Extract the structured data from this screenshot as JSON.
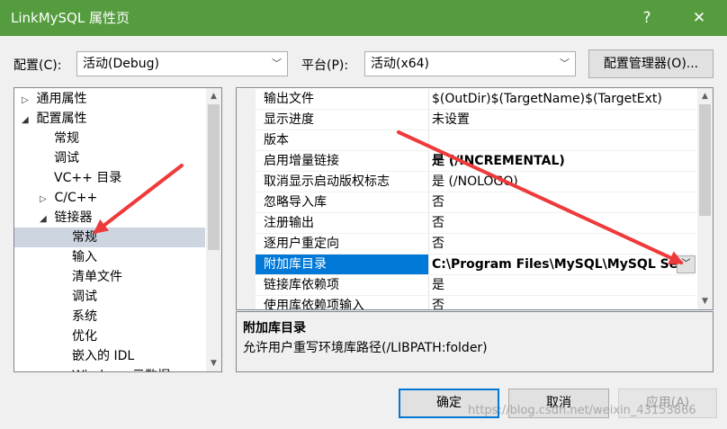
{
  "window": {
    "title": "LinkMySQL 属性页",
    "help_glyph": "?",
    "close_glyph": "✕"
  },
  "toolbar": {
    "config_label": "配置(C):",
    "config_value": "活动(Debug)",
    "platform_label": "平台(P):",
    "platform_value": "活动(x64)",
    "config_manager_label": "配置管理器(O)..."
  },
  "tree": {
    "items": [
      {
        "label": "通用属性",
        "arrow": "▷"
      },
      {
        "label": "配置属性",
        "arrow": "◢"
      },
      {
        "label": "常规",
        "arrow": ""
      },
      {
        "label": "调试",
        "arrow": ""
      },
      {
        "label": "VC++ 目录",
        "arrow": ""
      },
      {
        "label": "C/C++",
        "arrow": "▷"
      },
      {
        "label": "链接器",
        "arrow": "◢"
      },
      {
        "label": "常规",
        "arrow": ""
      },
      {
        "label": "输入",
        "arrow": ""
      },
      {
        "label": "清单文件",
        "arrow": ""
      },
      {
        "label": "调试",
        "arrow": ""
      },
      {
        "label": "系统",
        "arrow": ""
      },
      {
        "label": "优化",
        "arrow": ""
      },
      {
        "label": "嵌入的 IDL",
        "arrow": ""
      },
      {
        "label": "Windows 元数据",
        "arrow": ""
      }
    ]
  },
  "properties": [
    {
      "name": "输出文件",
      "value": "$(OutDir)$(TargetName)$(TargetExt)"
    },
    {
      "name": "显示进度",
      "value": "未设置"
    },
    {
      "name": "版本",
      "value": ""
    },
    {
      "name": "启用增量链接",
      "value": "是 (/INCREMENTAL)"
    },
    {
      "name": "取消显示启动版权标志",
      "value": "是 (/NOLOGO)"
    },
    {
      "name": "忽略导入库",
      "value": "否"
    },
    {
      "name": "注册输出",
      "value": "否"
    },
    {
      "name": "逐用户重定向",
      "value": "否"
    },
    {
      "name": "附加库目录",
      "value": "C:\\Program Files\\MySQL\\MySQL Server"
    },
    {
      "name": "链接库依赖项",
      "value": "是"
    },
    {
      "name": "使用库依赖项输入",
      "value": "否"
    }
  ],
  "description": {
    "title": "附加库目录",
    "text": "允许用户重写环境库路径(/LIBPATH:folder)"
  },
  "buttons": {
    "ok": "确定",
    "cancel": "取消",
    "apply": "应用(A)"
  },
  "watermark": "https://blog.csdn.net/weixin_43153866",
  "colors": {
    "titlebar": "#549c3e",
    "selection": "#0078d7",
    "tree_selection": "#cdd5e1",
    "annotation_arrow": "#ee3a3a"
  }
}
